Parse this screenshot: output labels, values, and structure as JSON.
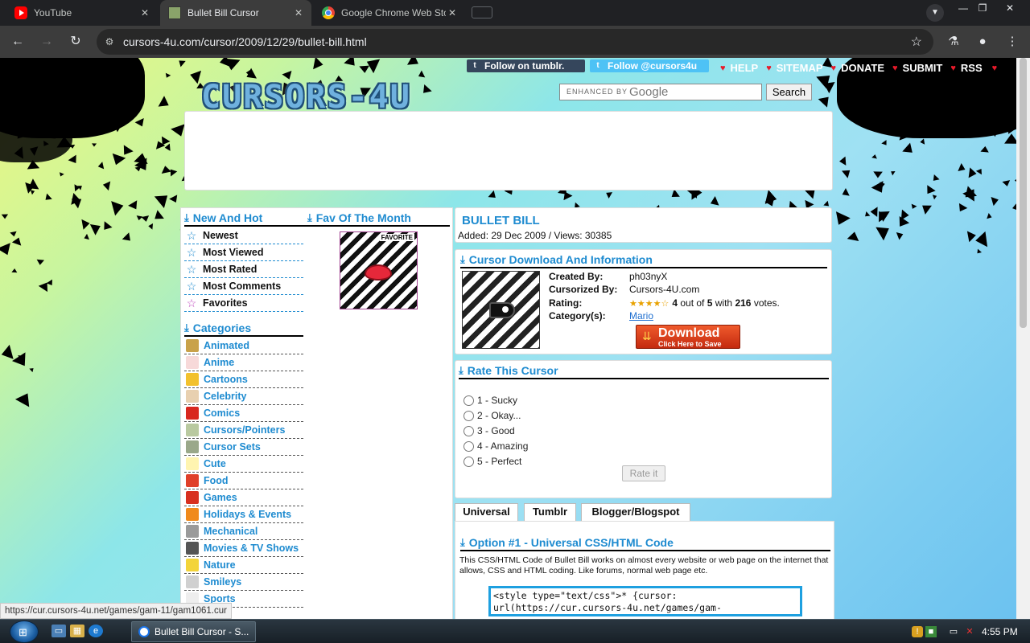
{
  "browser": {
    "tabs": [
      {
        "title": "YouTube",
        "close": "✕"
      },
      {
        "title": "Bullet Bill Cursor",
        "close": "✕"
      },
      {
        "title": "Google Chrome Web Store",
        "close": "✕"
      }
    ],
    "url": "cursors-4u.com/cursor/2009/12/29/bullet-bill.html"
  },
  "site": {
    "logo": "CURSORS-4U",
    "topbar": {
      "tumblr_label": "Follow on tumblr.",
      "twitter_label": "Follow @cursors4u",
      "links": [
        "HELP",
        "SITEMAP",
        "DONATE",
        "SUBMIT",
        "RSS"
      ]
    },
    "search": {
      "label": "ENHANCED BY",
      "brand": "Google",
      "button": "Search"
    }
  },
  "sidebar": {
    "new_hot_title": "New And Hot",
    "fav_month_title": "Fav Of The Month",
    "fav_badge": "FAVORITE",
    "nav": [
      "Newest",
      "Most Viewed",
      "Most Rated",
      "Most Comments",
      "Favorites"
    ],
    "categories_title": "Categories",
    "categories": [
      {
        "label": "Animated",
        "icon": "film-icon",
        "color": "#c9a24a"
      },
      {
        "label": "Anime",
        "icon": "cat-face-icon",
        "color": "#f7d9d9"
      },
      {
        "label": "Cartoons",
        "icon": "trophy-icon",
        "color": "#f2c12e"
      },
      {
        "label": "Celebrity",
        "icon": "face-icon",
        "color": "#e8d0b0"
      },
      {
        "label": "Comics",
        "icon": "superman-icon",
        "color": "#d8281f"
      },
      {
        "label": "Cursors/Pointers",
        "icon": "pointer-icon",
        "color": "#b9c9a0"
      },
      {
        "label": "Cursor Sets",
        "icon": "set-icon",
        "color": "#9aa88a"
      },
      {
        "label": "Cute",
        "icon": "cute-face-icon",
        "color": "#fff4b0"
      },
      {
        "label": "Food",
        "icon": "apple-icon",
        "color": "#e0402a"
      },
      {
        "label": "Games",
        "icon": "mushroom-icon",
        "color": "#d83020"
      },
      {
        "label": "Holidays & Events",
        "icon": "pumpkin-icon",
        "color": "#f08a1c"
      },
      {
        "label": "Mechanical",
        "icon": "gear-icon",
        "color": "#9a9a9a"
      },
      {
        "label": "Movies & TV Shows",
        "icon": "film-reel-icon",
        "color": "#555555"
      },
      {
        "label": "Nature",
        "icon": "sun-icon",
        "color": "#f3d43a"
      },
      {
        "label": "Smileys",
        "icon": "smiley-icon",
        "color": "#d0d0d0"
      },
      {
        "label": "Sports",
        "icon": "ball-icon",
        "color": "#eeeeee"
      }
    ]
  },
  "cursor": {
    "title": "BULLET BILL",
    "added_line": "Added: 29 Dec 2009 / Views: 30385",
    "download_section_title": "Cursor Download And Information",
    "info": {
      "created_by_label": "Created By:",
      "created_by": "ph03nyX",
      "cursorized_by_label": "Cursorized By:",
      "cursorized_by": "Cursors-4U.com",
      "rating_label": "Rating:",
      "rating_prefix": "4",
      "rating_mid1": "out of",
      "rating_out_of": "5",
      "rating_mid2": "with",
      "rating_votes": "216",
      "rating_suffix": "votes.",
      "category_label": "Category(s):",
      "category": "Mario"
    },
    "download_button": {
      "big": "Download",
      "small": "Click Here to Save"
    },
    "rate": {
      "title": "Rate This Cursor",
      "options": [
        "1 - Sucky",
        "2 - Okay...",
        "3 - Good",
        "4 - Amazing",
        "5 - Perfect"
      ],
      "button": "Rate it"
    },
    "code_tabs": [
      "Universal",
      "Tumblr",
      "Blogger/Blogspot"
    ],
    "option_title": "Option #1 - Universal CSS/HTML Code",
    "option_desc": "This CSS/HTML Code of Bullet Bill works on almost every website or web page on the internet that allows, CSS and HTML coding. Like forums, normal web page etc.",
    "code_line1": "<style type=\"text/css\">* {cursor:",
    "code_line2": "url(https://cur.cursors-4u.net/games/gam-"
  },
  "status_bar_url": "https://cur.cursors-4u.net/games/gam-11/gam1061.cur",
  "taskbar": {
    "task_label": "Bullet Bill Cursor - S...",
    "clock": "4:55 PM"
  }
}
